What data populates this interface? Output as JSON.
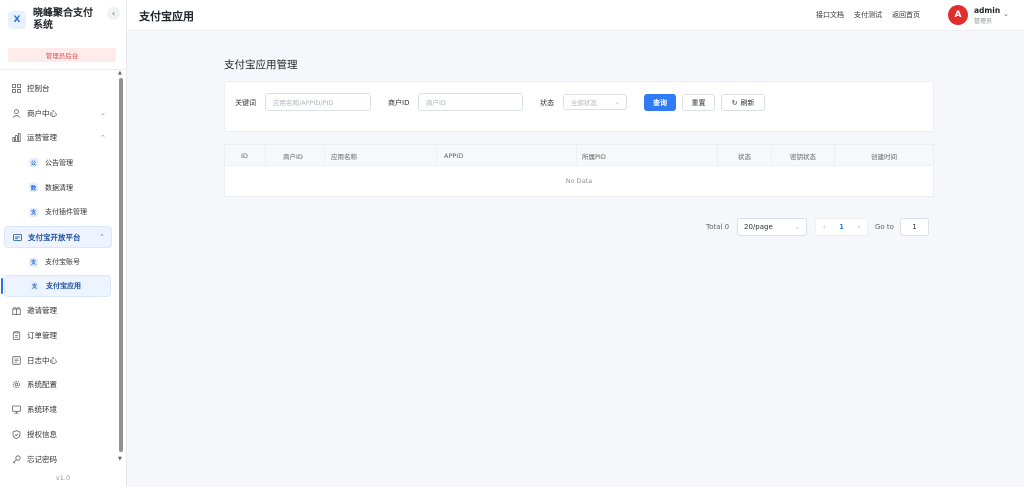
{
  "app": {
    "logo_letter": "X",
    "title": "晓峰聚合支付系统",
    "admin_tag": "管理员后台",
    "version": "v1.0"
  },
  "sidebar": {
    "items": [
      {
        "label": "控制台",
        "icon": "dashboard-icon"
      },
      {
        "label": "商户中心",
        "icon": "merchant-icon",
        "arrow": "⌄"
      },
      {
        "label": "运营管理",
        "icon": "chart-icon",
        "arrow": "⌃"
      }
    ],
    "ops_children": [
      {
        "badge": "公",
        "label": "公告管理"
      },
      {
        "badge": "数",
        "label": "数据清理"
      },
      {
        "badge": "支",
        "label": "支付插件管理"
      }
    ],
    "alipay_group": {
      "label": "支付宝开放平台",
      "arrow": "⌃"
    },
    "alipay_children": [
      {
        "badge": "支",
        "label": "支付宝账号"
      },
      {
        "badge": "支",
        "label": "支付宝应用"
      }
    ],
    "bottom_items": [
      {
        "label": "邀请管理"
      },
      {
        "label": "订单管理"
      },
      {
        "label": "日志中心"
      },
      {
        "label": "系统配置"
      },
      {
        "label": "系统环境"
      },
      {
        "label": "授权信息"
      },
      {
        "label": "忘记密码"
      }
    ]
  },
  "header": {
    "title": "支付宝应用",
    "links": [
      "接口文档",
      "支付测试",
      "返回首页"
    ],
    "user": {
      "avatar": "A",
      "name": "admin",
      "role": "管理员"
    }
  },
  "main": {
    "section_title": "支付宝应用管理",
    "filters": {
      "keyword_label": "关键词",
      "keyword_placeholder": "应用名称/APPID/PID",
      "merchant_label": "商户ID",
      "merchant_placeholder": "商户ID",
      "status_label": "状态",
      "status_value": "全部状态",
      "query": "查询",
      "reset": "重置",
      "refresh": "刷新"
    },
    "table": {
      "columns": [
        "ID",
        "商户ID",
        "应用名称",
        "APPID",
        "所属PID",
        "状态",
        "密钥状态",
        "创建时间"
      ],
      "empty": "No Data"
    },
    "pagination": {
      "total": "Total 0",
      "page_size": "20/page",
      "current": "1",
      "goto_label": "Go to",
      "goto_value": "1"
    }
  }
}
